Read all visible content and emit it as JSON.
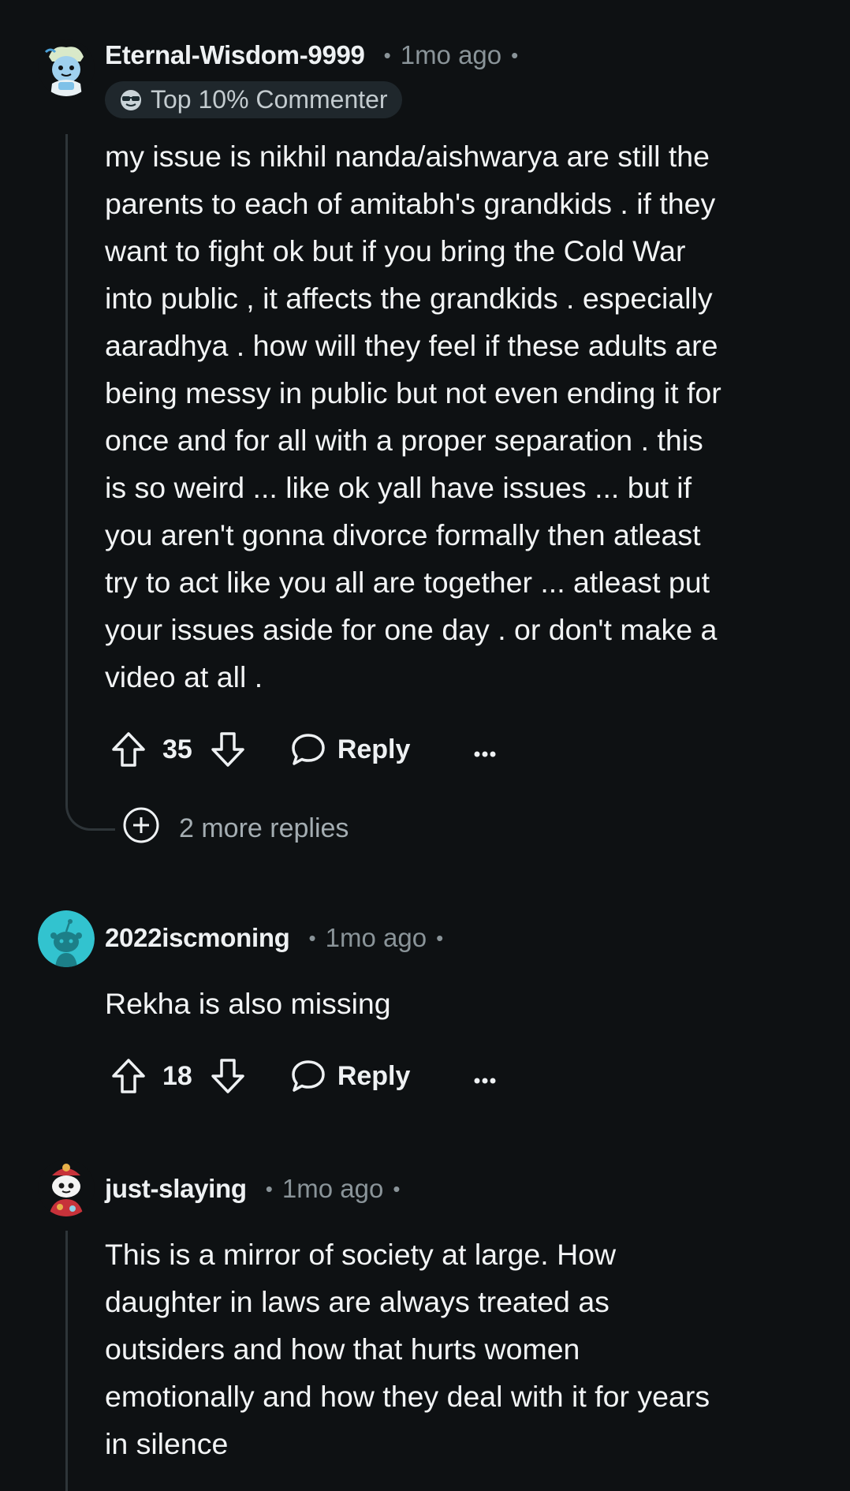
{
  "comments": [
    {
      "username": "Eternal-Wisdom-9999",
      "time": "1mo ago",
      "flair": "Top 10% Commenter",
      "body_lines": [
        "my issue is nikhil nanda/aishwarya are still the",
        "parents to each of amitabh's grandkids . if they",
        "want to fight ok but if you bring the Cold War",
        "into public , it affects the grandkids . especially",
        "aaradhya . how will they feel if these adults are",
        "being messy in public but not even ending it for",
        "once and for all with a proper separation . this",
        "is so weird ... like ok yall have issues ... but if",
        "you aren't gonna divorce formally then atleast",
        "try to act like you all are together ... atleast put",
        "your issues aside for one day . or don't make a",
        "video at all ."
      ],
      "score": "35",
      "reply_label": "Reply",
      "more_replies_label": "2 more replies"
    },
    {
      "username": "2022iscmoning",
      "time": "1mo ago",
      "body_lines": [
        "Rekha is also missing"
      ],
      "score": "18",
      "reply_label": "Reply"
    },
    {
      "username": "just-slaying",
      "time": "1mo ago",
      "body_lines": [
        "This is a mirror of society at large. How",
        "daughter in laws are always treated as",
        "outsiders and how that hurts women",
        "emotionally and how they deal with it for years",
        "in silence"
      ]
    }
  ],
  "icons": {
    "upvote": "upvote-arrow-icon",
    "downvote": "downvote-arrow-icon",
    "reply": "speech-bubble-icon",
    "more": "ellipsis-icon",
    "expand": "plus-circle-icon"
  },
  "colors": {
    "background": "#0e1113",
    "text": "#f2f4f5",
    "meta": "#8a9499",
    "thread_line": "#2e3539",
    "flair_bg": "#1f272c"
  }
}
